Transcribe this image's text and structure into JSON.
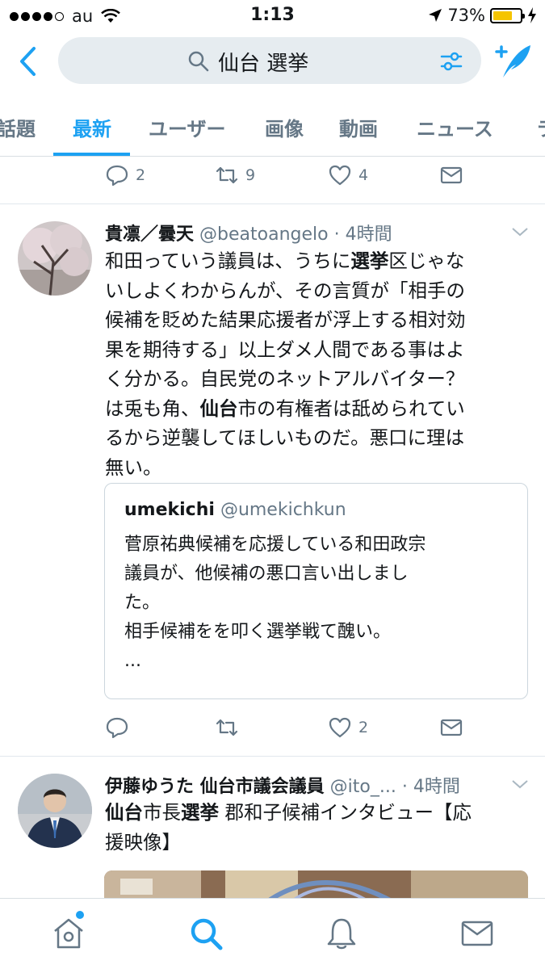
{
  "status_bar": {
    "carrier": "au",
    "time": "1:13",
    "battery": "73%",
    "battery_level": 0.73
  },
  "search": {
    "query": "仙台 選挙"
  },
  "tabs": [
    {
      "label": "話題"
    },
    {
      "label": "最新"
    },
    {
      "label": "ユーザー"
    },
    {
      "label": "画像"
    },
    {
      "label": "動画"
    },
    {
      "label": "ニュース"
    },
    {
      "label": "ラ"
    }
  ],
  "active_tab": "最新",
  "top_actions": {
    "reply_count": "2",
    "retweet_count": "9",
    "like_count": "4"
  },
  "tweet1": {
    "name": "貴凛／曇天",
    "handle": "@beatoangelo",
    "time": "· 4時間",
    "lines": [
      [
        "和田っていう議員は、うちに",
        "選挙",
        "区じゃな"
      ],
      [
        "いしよくわからんが、その言質が「相手の"
      ],
      [
        "候補を貶めた結果応援者が浮上する相対効"
      ],
      [
        "果を期待する」以上ダメ人間である事はよ"
      ],
      [
        "く分かる。自民党のネットアルバイター？"
      ],
      [
        "は兎も角、",
        "仙台",
        "市の有権者は舐められてい"
      ],
      [
        "るから逆襲してほしいものだ。悪口に理は"
      ],
      [
        "無い。"
      ]
    ],
    "quote": {
      "name": "umekichi",
      "handle": "@umekichkun",
      "lines": [
        "菅原祐典候補を応援している和田政宗",
        "議員が、他候補の悪口言い出しまし",
        "た。",
        "相手候補をを叩く選挙戦て醜い。",
        "..."
      ]
    },
    "reply_count": "",
    "retweet_count": "",
    "like_count": "2"
  },
  "tweet2": {
    "name": "伊藤ゆうた 仙台市議会議員",
    "handle": "@ito_...",
    "time": "· 4時間",
    "lines": [
      [
        "",
        "仙台",
        "市長",
        "選挙",
        " 郡和子候補インタビュー【応"
      ],
      [
        "援映像】"
      ]
    ]
  },
  "colors": {
    "accent": "#1da1f2",
    "text": "#14171a",
    "secondary": "#657786",
    "border": "#e1e8ed",
    "search_bg": "#e6ecf0",
    "battery": "#f5c400"
  },
  "icons": {
    "back": "chevron-left-icon",
    "search": "magnifier-icon",
    "filter": "sliders-icon",
    "compose": "compose-quill-icon",
    "reply": "speech-bubble-icon",
    "retweet": "retweet-icon",
    "like": "heart-icon",
    "dm": "envelope-icon",
    "home": "home-icon",
    "explore": "search-icon",
    "notifications": "bell-icon",
    "messages": "envelope-icon"
  }
}
